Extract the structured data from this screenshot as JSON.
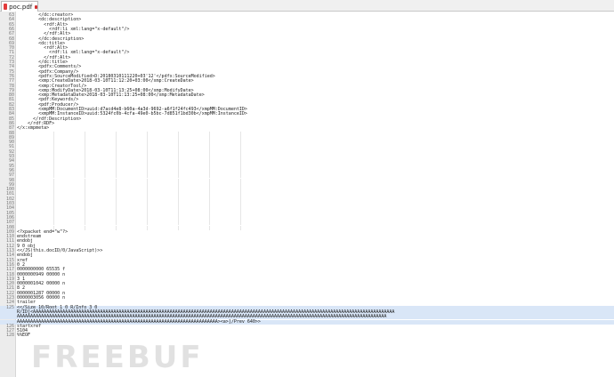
{
  "tab": {
    "title": "poc.pdf",
    "icon": "pdf-file-icon",
    "close_icon": "close-icon"
  },
  "lines": [
    {
      "n": "63",
      "t": "        </dc:creator>"
    },
    {
      "n": "64",
      "t": "        <dc:description>"
    },
    {
      "n": "65",
      "t": "          <rdf:Alt>"
    },
    {
      "n": "66",
      "t": "            <rdf:li xml:lang=\"x-default\"/>"
    },
    {
      "n": "67",
      "t": "          </rdf:Alt>"
    },
    {
      "n": "68",
      "t": "        </dc:description>"
    },
    {
      "n": "69",
      "t": "        <dc:title>"
    },
    {
      "n": "70",
      "t": "          <rdf:Alt>"
    },
    {
      "n": "71",
      "t": "            <rdf:li xml:lang=\"x-default\"/>"
    },
    {
      "n": "72",
      "t": "          </rdf:Alt>"
    },
    {
      "n": "73",
      "t": "        </dc:title>"
    },
    {
      "n": "74",
      "t": "        <pdfx:Comments/>"
    },
    {
      "n": "75",
      "t": "        <pdfx:Company/>"
    },
    {
      "n": "76",
      "t": "        <pdfx:SourceModified>D:20180310111220+03'12'</pdfx:SourceModified>"
    },
    {
      "n": "77",
      "t": "        <xmp:CreateDate>2018-03-10T11:12:20+03:00</xmp:CreateDate>"
    },
    {
      "n": "78",
      "t": "        <xmp:CreatorTool/>"
    },
    {
      "n": "79",
      "t": "        <xmp:ModifyDate>2018-03-10T11:13:25+08:00</xmp:ModifyDate>"
    },
    {
      "n": "80",
      "t": "        <xmp:MetadataDate>2018-03-10T11:13:25+08:00</xmp:MetadataDate>"
    },
    {
      "n": "81",
      "t": "        <pdf:Keywords/>"
    },
    {
      "n": "82",
      "t": "        <pdf:Producer/>"
    },
    {
      "n": "83",
      "t": "        <xmpMM:DocumentID>uuid:d7acd4e8-b60a-4a3d-9692-a6f1f24fc493</xmpMM:DocumentID>"
    },
    {
      "n": "84",
      "t": "        <xmpMM:InstanceID>uuid:5324fc0b-4cfa-49e0-b5bc-7d851f1bd30b</xmpMM:InstanceID>"
    },
    {
      "n": "85",
      "t": "      </rdf:Description>"
    },
    {
      "n": "86",
      "t": "    </rdf:RDF>"
    },
    {
      "n": "87",
      "t": "</x:xmpmeta>"
    },
    {
      "n": "88",
      "t": ""
    },
    {
      "n": "89",
      "t": ""
    },
    {
      "n": "90",
      "t": ""
    },
    {
      "n": "91",
      "t": ""
    },
    {
      "n": "92",
      "t": ""
    },
    {
      "n": "93",
      "t": ""
    },
    {
      "n": "94",
      "t": ""
    },
    {
      "n": "95",
      "t": ""
    },
    {
      "n": "96",
      "t": ""
    },
    {
      "n": "97",
      "t": ""
    },
    {
      "n": "98",
      "t": ""
    },
    {
      "n": "99",
      "t": ""
    },
    {
      "n": "100",
      "t": ""
    },
    {
      "n": "101",
      "t": ""
    },
    {
      "n": "102",
      "t": ""
    },
    {
      "n": "103",
      "t": ""
    },
    {
      "n": "104",
      "t": ""
    },
    {
      "n": "105",
      "t": ""
    },
    {
      "n": "106",
      "t": ""
    },
    {
      "n": "107",
      "t": ""
    },
    {
      "n": "108",
      "t": ""
    },
    {
      "n": "109",
      "t": "<?xpacket end=\"w\"?>"
    },
    {
      "n": "110",
      "t": "endstream"
    },
    {
      "n": "111",
      "t": "endobj"
    },
    {
      "n": "112",
      "t": "9 0 obj"
    },
    {
      "n": "113",
      "t": "<</JS(this.docID/0/JavaScript)>>"
    },
    {
      "n": "114",
      "t": "endobj"
    },
    {
      "n": "115",
      "t": "xref"
    },
    {
      "n": "116",
      "t": "0 2"
    },
    {
      "n": "117",
      "t": "0000000000 65535 f"
    },
    {
      "n": "118",
      "t": "0000000949 00000 n"
    },
    {
      "n": "119",
      "t": "3 1"
    },
    {
      "n": "120",
      "t": "0000001042 00000 n"
    },
    {
      "n": "121",
      "t": "8 2"
    },
    {
      "n": "122",
      "t": "0000001287 00000 n"
    },
    {
      "n": "123",
      "t": "0000003056 00000 n"
    },
    {
      "n": "124",
      "t": "trailer"
    },
    {
      "n": "125",
      "t": "<</Size 10/Root 1 0 R/Info 3 0",
      "hl": true
    },
    {
      "n": "",
      "t": "R/ID[<AAAAAAAAAAAAAAAAAAAAAAAAAAAAAAAAAAAAAAAAAAAAAAAAAAAAAAAAAAAAAAAAAAAAAAAAAAAAAAAAAAAAAAAAAAAAAAAAAAAAAAAAAAAAAAAAAAAAAAAAAAAAAAAAAAAAAAA",
      "hl": true
    },
    {
      "n": "",
      "t": "AAAAAAAAAAAAAAAAAAAAAAAAAAAAAAAAAAAAAAAAAAAAAAAAAAAAAAAAAAAAAAAAAAAAAAAAAAAAAAAAAAAAAAAAAAAAAAAAAAAAAAAAAAAAAAAAAAAAAAAAAAAAAAAAAAAAAAAAAA",
      "hl": true
    },
    {
      "n": "",
      "t": "AAAAAAAAAAAAAAAAAAAAAAAAAAAAAAAAAAAAAAAAAAAAAAAAAAAAAAAAAAAAAAAAAAAAAAAAAAA><a>]/Prev 640>>",
      "hl": true
    },
    {
      "n": "126",
      "t": "startxref"
    },
    {
      "n": "127",
      "t": "5104"
    },
    {
      "n": "128",
      "t": "%%EOF"
    }
  ],
  "colors": {
    "highlight": "#d9e6f7",
    "gutter": "#ececec",
    "tab_icon": "#e23b3b"
  }
}
